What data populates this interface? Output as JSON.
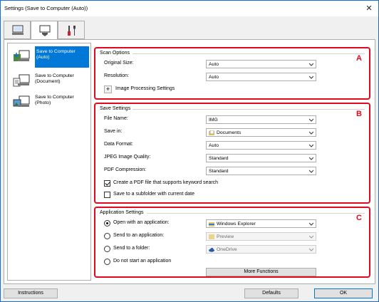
{
  "window": {
    "title": "Settings (Save to Computer (Auto))",
    "close_glyph": "✕"
  },
  "tabs": [
    {
      "name": "scan-from-computer",
      "icon": "computer-scan-icon",
      "active": false
    },
    {
      "name": "scan-from-operation-panel",
      "icon": "scanner-panel-icon",
      "active": true
    },
    {
      "name": "general-settings",
      "icon": "tools-icon",
      "active": false
    }
  ],
  "sidebar": {
    "items": [
      {
        "label": "Save to Computer (Auto)",
        "icon": "save-auto-icon",
        "selected": true
      },
      {
        "label": "Save to Computer (Document)",
        "icon": "save-document-icon",
        "selected": false
      },
      {
        "label": "Save to Computer (Photo)",
        "icon": "save-photo-icon",
        "selected": false
      }
    ]
  },
  "scan_options": {
    "title": "Scan Options",
    "marker": "A",
    "original_size_label": "Original Size:",
    "original_size_value": "Auto",
    "resolution_label": "Resolution:",
    "resolution_value": "Auto",
    "image_processing_plus": "+",
    "image_processing_label": "Image Processing Settings"
  },
  "save_settings": {
    "title": "Save Settings",
    "marker": "B",
    "file_name_label": "File Name:",
    "file_name_value": "IMG",
    "save_in_label": "Save in:",
    "save_in_value": "Documents",
    "data_format_label": "Data Format:",
    "data_format_value": "Auto",
    "jpeg_quality_label": "JPEG Image Quality:",
    "jpeg_quality_value": "Standard",
    "pdf_compression_label": "PDF Compression:",
    "pdf_compression_value": "Standard",
    "keyword_pdf_label": "Create a PDF file that supports keyword search",
    "keyword_pdf_checked": true,
    "subfolder_label": "Save to a subfolder with current date",
    "subfolder_checked": false
  },
  "application_settings": {
    "title": "Application Settings",
    "marker": "C",
    "open_app_label": "Open with an application:",
    "open_app_value": "Windows Explorer",
    "send_app_label": "Send to an application:",
    "send_app_value": "Preview",
    "send_folder_label": "Send to a folder:",
    "send_folder_value": "OneDrive",
    "no_app_label": "Do not start an application",
    "selected_option": "open_app",
    "more_functions_label": "More Functions"
  },
  "footer": {
    "instructions_label": "Instructions",
    "defaults_label": "Defaults",
    "ok_label": "OK"
  },
  "colors": {
    "highlight": "#e00a1e",
    "selection": "#0078d7",
    "window_border": "#1b6fc8"
  }
}
